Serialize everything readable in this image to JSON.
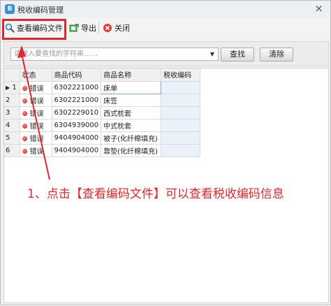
{
  "window": {
    "title": "税收编码管理"
  },
  "toolbar": {
    "view_file_label": "查看编码文件",
    "export_label": "导出",
    "close_label": "关闭"
  },
  "search": {
    "placeholder": "请输入要查找的字符串……",
    "find_label": "查找",
    "clear_label": "清除"
  },
  "table": {
    "columns": [
      "状态",
      "商品代码",
      "商品名称",
      "税收编码"
    ],
    "rows": [
      {
        "num": "1",
        "status": "错误",
        "code": "6302221000",
        "name": "床单",
        "tax": ""
      },
      {
        "num": "2",
        "status": "错误",
        "code": "6302221000",
        "name": "床笠",
        "tax": ""
      },
      {
        "num": "3",
        "status": "错误",
        "code": "6302229010",
        "name": "西式枕套",
        "tax": ""
      },
      {
        "num": "4",
        "status": "错误",
        "code": "6304939000",
        "name": "中式枕套",
        "tax": ""
      },
      {
        "num": "5",
        "status": "错误",
        "code": "9404904000",
        "name": "被子(化纤棉填充)",
        "tax": ""
      },
      {
        "num": "6",
        "status": "错误",
        "code": "9404904000",
        "name": "靠垫(化纤棉填充)",
        "tax": ""
      }
    ]
  },
  "annotation": {
    "text": "1、点击【查看编码文件】可以查看税收编码信息"
  },
  "colors": {
    "accent_red": "#e0262e",
    "status_dot": "#c21010"
  }
}
